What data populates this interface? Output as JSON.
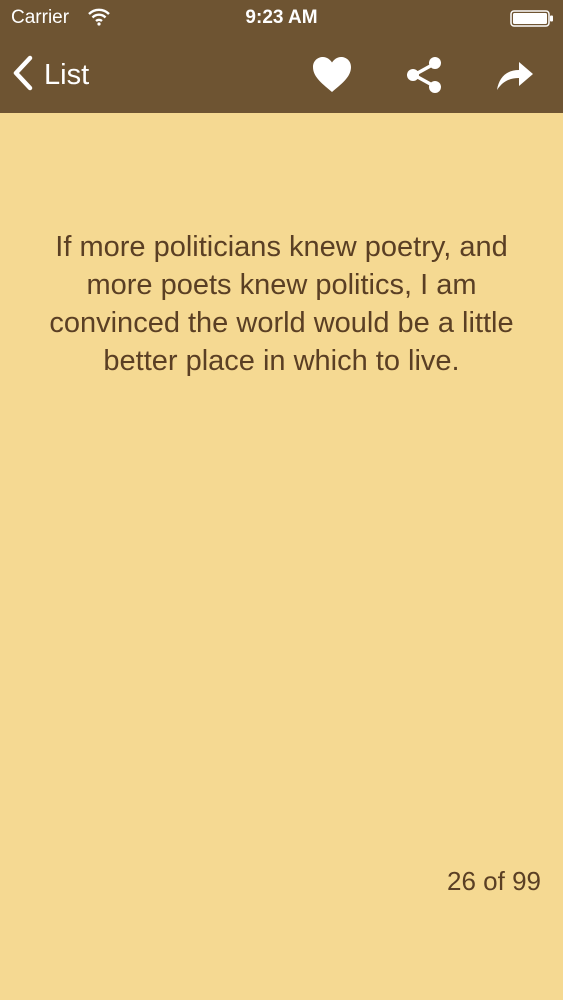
{
  "status_bar": {
    "carrier": "Carrier",
    "time": "9:23 AM",
    "wifi_icon": "wifi-icon",
    "battery_icon": "battery-icon"
  },
  "nav_bar": {
    "back_label": "List",
    "back_icon": "chevron-left-icon",
    "actions": [
      "heart-icon",
      "share-icon",
      "forward-arrow-icon"
    ]
  },
  "quote": {
    "text": "If more politicians knew poetry, and more poets knew politics, I am convinced the world would be a little better place in which to live."
  },
  "pagination": {
    "label": "26 of 99"
  },
  "colors": {
    "nav_background": "#6e5432",
    "page_background": "#f5d992",
    "text": "#5a3f24",
    "icon": "#ffffff"
  }
}
